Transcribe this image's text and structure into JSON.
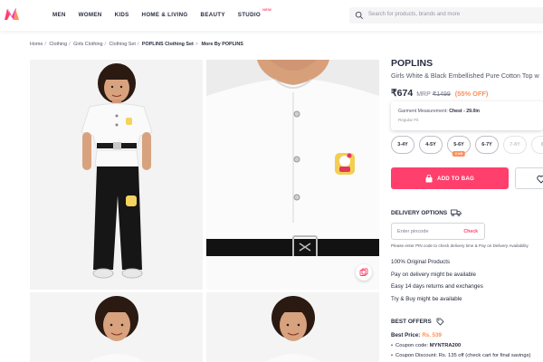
{
  "header": {
    "logo": "myntra-logo-icon",
    "nav": [
      {
        "label": "MEN"
      },
      {
        "label": "WOMEN"
      },
      {
        "label": "KIDS"
      },
      {
        "label": "HOME & LIVING"
      },
      {
        "label": "BEAUTY"
      },
      {
        "label": "STUDIO",
        "badge": "NEW"
      }
    ],
    "search": {
      "placeholder": "Search for products, brands and more",
      "icon": "search-icon"
    }
  },
  "breadcrumb": [
    {
      "label": "Home"
    },
    {
      "label": "Clothing"
    },
    {
      "label": "Girls Clothing"
    },
    {
      "label": "Clothing Set"
    },
    {
      "label": "POPLINS Clothing Set",
      "strong": true
    },
    {
      "label": "More By POPLINS",
      "strong": true
    }
  ],
  "product": {
    "brand": "POPLINS",
    "name": "Girls White & Black Embellished Pure Cotton Top w",
    "price": "₹674",
    "mrp_label": "MRP",
    "mrp": "₹1499",
    "discount": "(55% OFF)",
    "measurement": {
      "label": "Garment Measurement:",
      "value": "Chest - 29.0in",
      "fit": "Regular Fit"
    },
    "sizes": [
      {
        "label": "3-4Y",
        "available": true
      },
      {
        "label": "4-5Y",
        "available": true
      },
      {
        "label": "5-6Y",
        "available": true,
        "tag": "4 left"
      },
      {
        "label": "6-7Y",
        "available": true
      },
      {
        "label": "7-8Y",
        "available": false
      },
      {
        "label": "8-",
        "available": false
      }
    ],
    "add_to_bag": "ADD TO BAG",
    "wishlist_icon": "heart-icon"
  },
  "delivery": {
    "title": "DELIVERY OPTIONS",
    "pincode_placeholder": "Enter pincode",
    "check": "Check",
    "help": "Please enter PIN code to check delivery time & Pay on Delivery Availability"
  },
  "features": [
    "100% Original Products",
    "Pay on delivery might be available",
    "Easy 14 days returns and exchanges",
    "Try & Buy might be available"
  ],
  "offers": {
    "title": "BEST OFFERS",
    "best_price_label": "Best Price:",
    "best_price": "Rs. 539",
    "items": [
      {
        "label": "Coupon code:",
        "value": "MYNTRA200"
      },
      {
        "label": "Coupon Discount: Rs. 135 off (check cart for final savings)",
        "value": ""
      }
    ]
  },
  "colors": {
    "accent": "#ff3f6c",
    "discount": "#ff905a",
    "text": "#282c3f"
  }
}
